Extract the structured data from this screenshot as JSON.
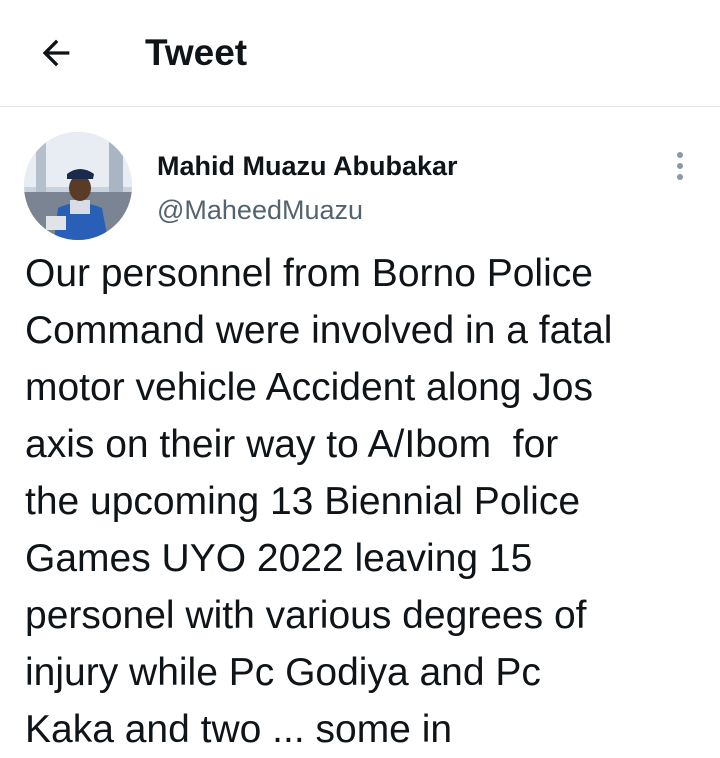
{
  "header": {
    "title": "Tweet",
    "back_icon": "arrow-left-icon"
  },
  "author": {
    "display_name": "Mahid Muazu Abubakar",
    "handle": "@MaheedMuazu",
    "avatar_icon": "user-avatar",
    "more_icon": "more-vertical-icon"
  },
  "tweet": {
    "text": "Our personnel from Borno Police\nCommand were involved in a fatal\nmotor vehicle Accident along Jos\naxis on their way to A/Ibom  for\nthe upcoming 13 Biennial Police\nGames UYO 2022 leaving 15\npersonel with various degrees of\ninjury while Pc Godiya and Pc\nKaka and two ... some in"
  },
  "colors": {
    "text": "#0f1419",
    "secondary": "#536471",
    "divider": "#e1e4e8",
    "uniform_blue": "#2a5fb8"
  }
}
